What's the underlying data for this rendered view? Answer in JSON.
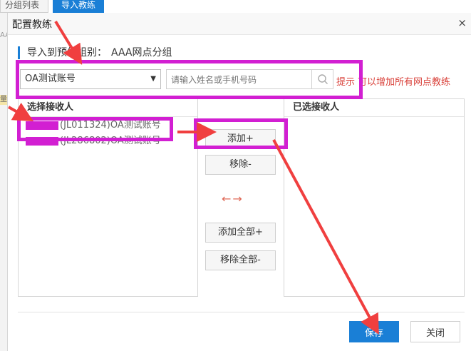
{
  "background": {
    "tab_group_list": "分组列表",
    "tab_import_trainer": "导入教练",
    "left_fragment": "AA",
    "left_fragment2": "量"
  },
  "dialog": {
    "title": "配置教练",
    "close_icon": "×",
    "section_prefix": "导入到预约组别：",
    "section_group": "AAA网点分组",
    "account_select": {
      "selected": "OA测试账号",
      "caret": "▼"
    },
    "search": {
      "placeholder": "请输入姓名或手机号码",
      "icon": "search-icon"
    },
    "tip": {
      "label": "提示",
      "text": "可以增加所有网点教练"
    },
    "left_panel": {
      "title": "选择接收人",
      "items": [
        {
          "label": "(JL011324)OA测试账号"
        },
        {
          "label": "(JL286802)OA测试账号"
        }
      ]
    },
    "right_panel": {
      "title": "已选接收人",
      "items": []
    },
    "buttons": {
      "add": "添加+",
      "remove": "移除-",
      "add_all": "添加全部+",
      "remove_all": "移除全部-",
      "save": "保存",
      "close": "关闭"
    },
    "arrows_hint": "←→"
  },
  "colors": {
    "accent": "#1a7fd6",
    "highlight": "#d21fd2",
    "annotation_arrow": "#f03f3f",
    "tip_red": "#d9413a"
  }
}
